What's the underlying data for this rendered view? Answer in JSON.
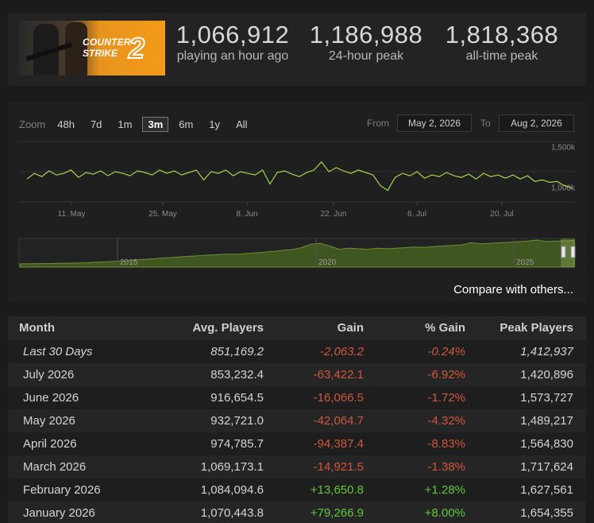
{
  "header": {
    "logo_text_line1": "COUNTER",
    "logo_text_line2": "STRIKE",
    "logo_number": "2",
    "stats": [
      {
        "value": "1,066,912",
        "label": "playing an hour ago"
      },
      {
        "value": "1,186,988",
        "label": "24-hour peak"
      },
      {
        "value": "1,818,368",
        "label": "all-time peak"
      }
    ]
  },
  "chart_controls": {
    "zoom_label": "Zoom",
    "zoom_options": [
      "48h",
      "7d",
      "1m",
      "3m",
      "6m",
      "1y",
      "All"
    ],
    "active_zoom": "3m",
    "from_label": "From",
    "from_value": "May 2, 2026",
    "to_label": "To",
    "to_value": "Aug 2, 2026",
    "compare_link": "Compare with others..."
  },
  "chart_data": [
    {
      "type": "line",
      "x_ticks": [
        "11. May",
        "25. May",
        "8. Jun",
        "22. Jun",
        "6. Jul",
        "20. Jul"
      ],
      "y_ticks": [
        "1,500k",
        "1,000k"
      ],
      "y_range_k": [
        880,
        1620
      ],
      "series": [
        {
          "color": "#a4d44e",
          "values_k": [
            1160,
            1230,
            1190,
            1260,
            1210,
            1230,
            1270,
            1180,
            1240,
            1220,
            1260,
            1200,
            1250,
            1230,
            1200,
            1260,
            1240,
            1210,
            1270,
            1230,
            1260,
            1210,
            1240,
            1270,
            1150,
            1250,
            1230,
            1270,
            1200,
            1250,
            1230,
            1210,
            1270,
            1100,
            1240,
            1260,
            1220,
            1190,
            1240,
            1270,
            1370,
            1250,
            1300,
            1260,
            1230,
            1270,
            1240,
            1210,
            1080,
            1020,
            1180,
            1230,
            1200,
            1250,
            1170,
            1210,
            1190,
            1240,
            1200,
            1180,
            1220,
            1160,
            1230,
            1190,
            1210,
            1170,
            1210,
            1160,
            1200,
            1130,
            1150,
            1120,
            1130,
            1080,
            1050
          ]
        }
      ]
    },
    {
      "type": "area",
      "x_ticks": [
        "2015",
        "2020",
        "2025"
      ],
      "series": [
        {
          "color": "#5d7d2e",
          "values_rel": [
            0.12,
            0.12,
            0.13,
            0.13,
            0.14,
            0.14,
            0.15,
            0.16,
            0.18,
            0.19,
            0.21,
            0.22,
            0.25,
            0.28,
            0.3,
            0.33,
            0.35,
            0.38,
            0.4,
            0.42,
            0.44,
            0.46,
            0.48,
            0.47,
            0.5,
            0.52,
            0.55,
            0.58,
            0.62,
            0.65,
            0.72,
            0.85,
            0.88,
            0.78,
            0.66,
            0.7,
            0.68,
            0.66,
            0.7,
            0.68,
            0.7,
            0.72,
            0.74,
            0.73,
            0.76,
            0.78,
            0.8,
            0.82,
            0.9,
            0.86,
            0.88,
            0.9,
            0.92,
            0.94,
            0.96,
            1.0,
            0.95,
            0.96,
            0.97,
            0.98
          ]
        }
      ]
    }
  ],
  "table": {
    "headers": {
      "month": "Month",
      "avg": "Avg. Players",
      "gain": "Gain",
      "pct": "% Gain",
      "peak": "Peak Players"
    },
    "rows": [
      {
        "month": "Last 30 Days",
        "avg": "851,169.2",
        "gain": "-2,063.2",
        "pct": "-0.24%",
        "peak": "1,412,937"
      },
      {
        "month": "July 2026",
        "avg": "853,232.4",
        "gain": "-63,422.1",
        "pct": "-6.92%",
        "peak": "1,420,896"
      },
      {
        "month": "June 2026",
        "avg": "916,654.5",
        "gain": "-16,066.5",
        "pct": "-1.72%",
        "peak": "1,573,727"
      },
      {
        "month": "May 2026",
        "avg": "932,721.0",
        "gain": "-42,064.7",
        "pct": "-4.32%",
        "peak": "1,489,217"
      },
      {
        "month": "April 2026",
        "avg": "974,785.7",
        "gain": "-94,387.4",
        "pct": "-8.83%",
        "peak": "1,564,830"
      },
      {
        "month": "March 2026",
        "avg": "1,069,173.1",
        "gain": "-14,921.5",
        "pct": "-1.38%",
        "peak": "1,717,624"
      },
      {
        "month": "February 2026",
        "avg": "1,084,094.6",
        "gain": "+13,650.8",
        "pct": "+1.28%",
        "peak": "1,627,561"
      },
      {
        "month": "January 2026",
        "avg": "1,070,443.8",
        "gain": "+79,266.9",
        "pct": "+8.00%",
        "peak": "1,654,355"
      }
    ]
  },
  "colors": {
    "negative": "#d0563e",
    "positive": "#5fc83a",
    "line": "#a4d44e",
    "navigator_fill": "#3f5620"
  }
}
